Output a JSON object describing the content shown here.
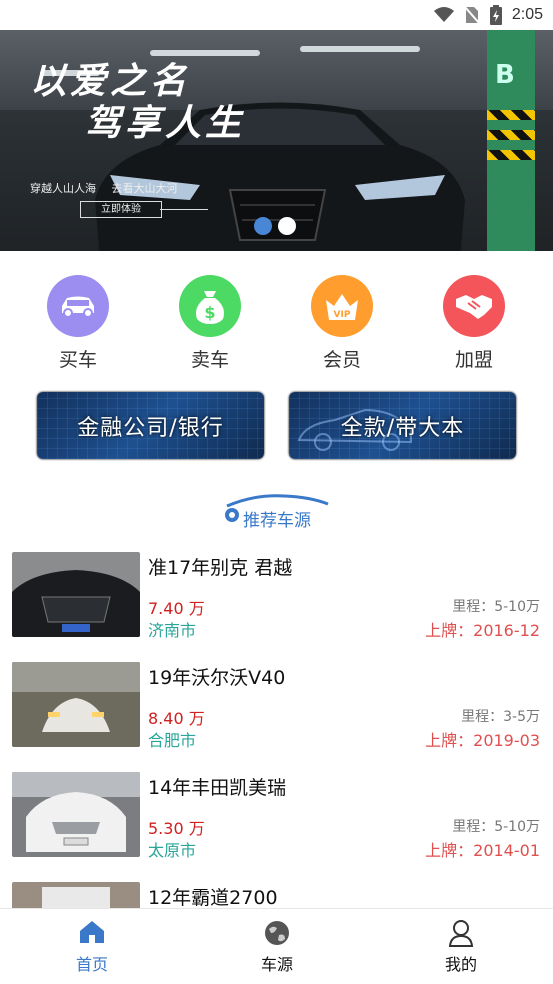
{
  "status_bar": {
    "time": "2:05"
  },
  "banner": {
    "headline_line1": "以爱之名",
    "headline_line2": "驾享人生",
    "sub_left": "穿越人山人海",
    "sub_right": "去看大山大河",
    "cta": "立即体验",
    "slide_count": 2,
    "active_slide": 1
  },
  "categories": [
    {
      "label": "买车",
      "icon": "car-icon",
      "color": "#9b8ef0"
    },
    {
      "label": "卖车",
      "icon": "money-bag-icon",
      "color": "#4cd964"
    },
    {
      "label": "会员",
      "icon": "vip-crown-icon",
      "color": "#ff9d2e"
    },
    {
      "label": "加盟",
      "icon": "handshake-icon",
      "color": "#f4555a"
    }
  ],
  "promos": [
    {
      "label": "金融公司/银行"
    },
    {
      "label": "全款/带大本"
    }
  ],
  "section": {
    "title": "推荐车源"
  },
  "cars": [
    {
      "title": "准17年别克 君越",
      "price": "7.40 万",
      "city": "济南市",
      "mileage": "里程：5-10万",
      "plate_date": "上牌：2016-12"
    },
    {
      "title": "19年沃尔沃V40",
      "price": "8.40 万",
      "city": "合肥市",
      "mileage": "里程：3-5万",
      "plate_date": "上牌：2019-03"
    },
    {
      "title": "14年丰田凯美瑞",
      "price": "5.30 万",
      "city": "太原市",
      "mileage": "里程：5-10万",
      "plate_date": "上牌：2014-01"
    },
    {
      "title": "12年霸道2700",
      "price": "",
      "city": "",
      "mileage": "",
      "plate_date": ""
    }
  ],
  "tabbar": [
    {
      "label": "首页",
      "icon": "home-icon",
      "active": true
    },
    {
      "label": "车源",
      "icon": "globe-icon",
      "active": false
    },
    {
      "label": "我的",
      "icon": "user-icon",
      "active": false
    }
  ],
  "colors": {
    "accent": "#3a78c9",
    "price": "#d02020",
    "city": "#2aa59a",
    "plate": "#e0504f"
  }
}
